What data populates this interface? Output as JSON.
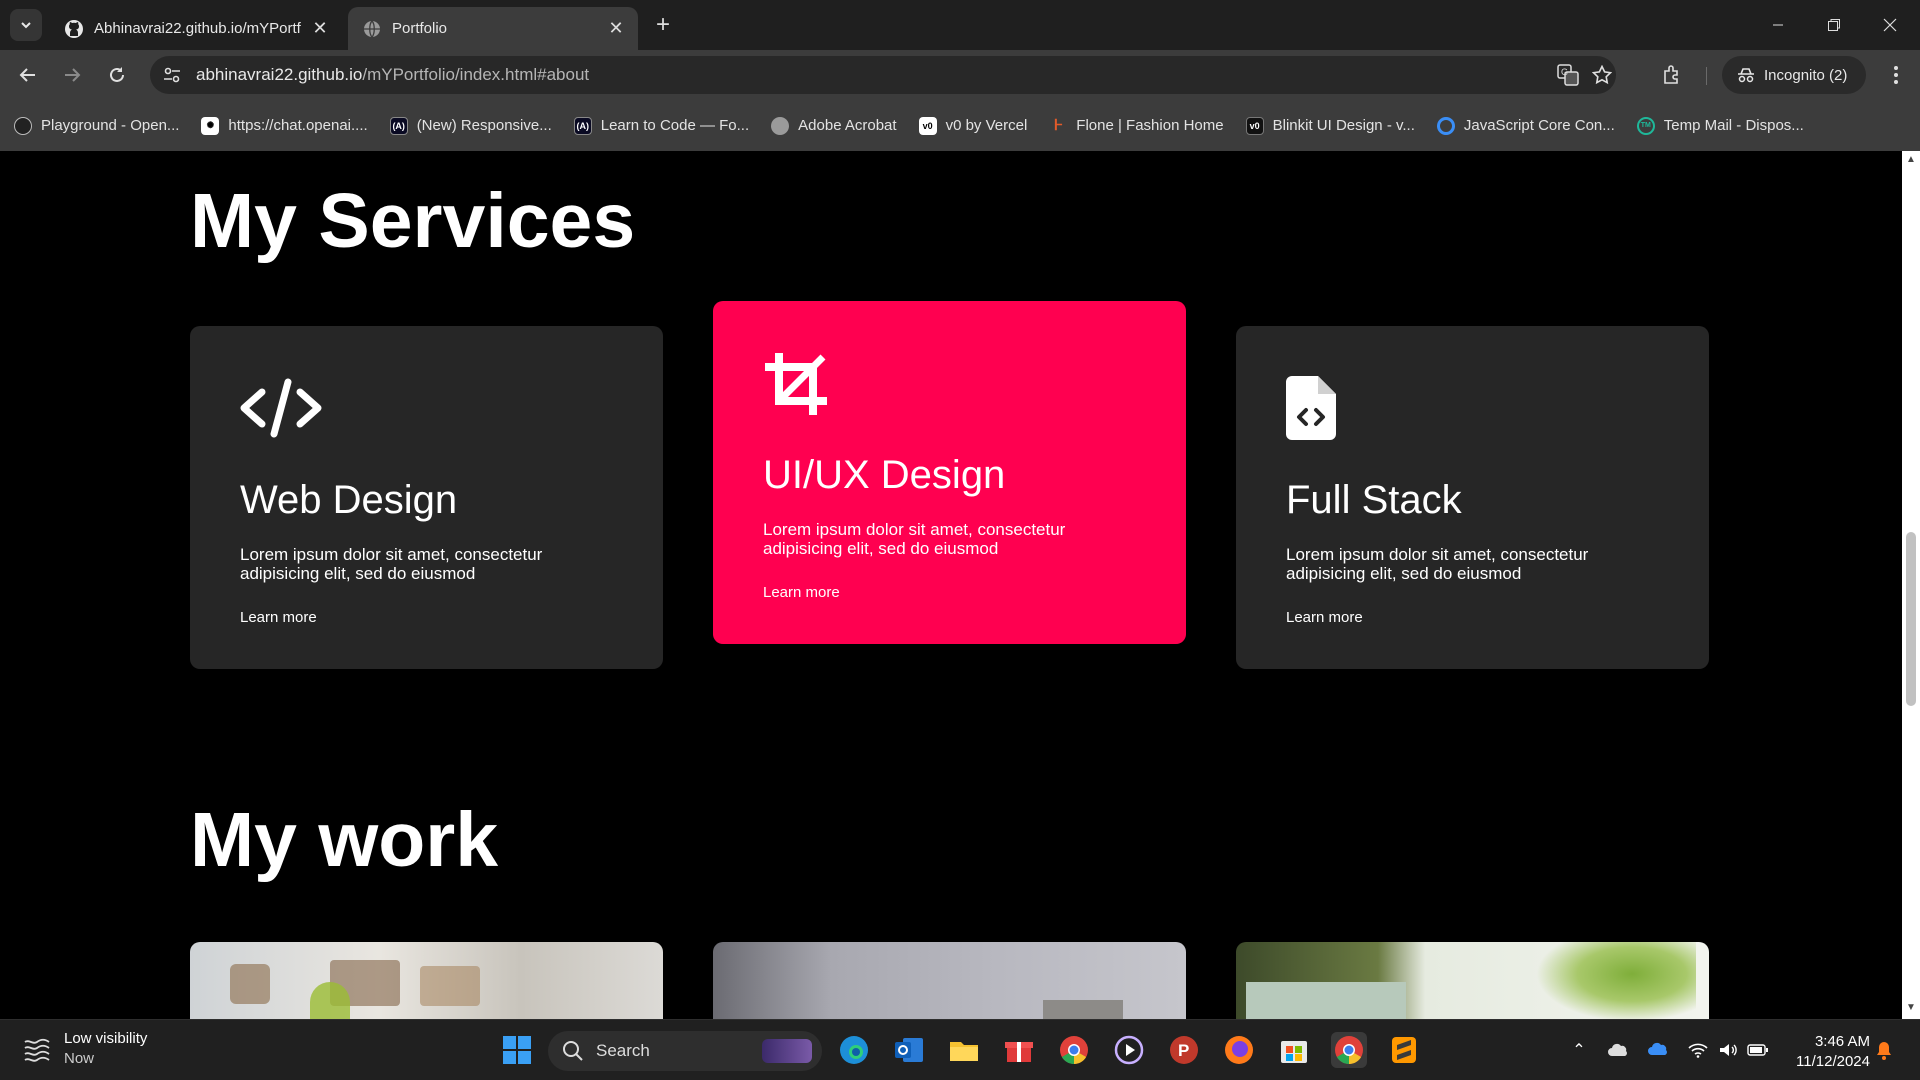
{
  "browser": {
    "tabs": [
      {
        "title": "Abhinavrai22.github.io/mYPortf",
        "icon": "github-icon",
        "active": false
      },
      {
        "title": "Portfolio",
        "icon": "globe-icon",
        "active": true
      }
    ],
    "url_host": "abhinavrai22.github.io",
    "url_path": "/mYPortfolio/index.html#about",
    "incognito_label": "Incognito (2)",
    "bookmarks": [
      {
        "label": "Playground - Open...",
        "icon": "openai-icon"
      },
      {
        "label": "https://chat.openai....",
        "icon": "openai-icon"
      },
      {
        "label": "(New) Responsive...",
        "icon": "code-angle-icon"
      },
      {
        "label": "Learn to Code — Fo...",
        "icon": "code-angle-icon"
      },
      {
        "label": "Adobe Acrobat",
        "icon": "globe-icon"
      },
      {
        "label": "v0 by Vercel",
        "icon": "v0-icon"
      },
      {
        "label": "Flone | Fashion Home",
        "icon": "flone-icon"
      },
      {
        "label": "Blinkit UI Design - v...",
        "icon": "v0-icon"
      },
      {
        "label": "JavaScript Core Con...",
        "icon": "q-icon"
      },
      {
        "label": "Temp Mail - Dispos...",
        "icon": "tempmail-icon"
      }
    ]
  },
  "page": {
    "services_title": "My Services",
    "services": [
      {
        "icon": "code-icon",
        "title": "Web Design",
        "desc": "Lorem ipsum dolor sit amet, consectetur adipisicing elit, sed do eiusmod",
        "link": "Learn more",
        "highlight": false
      },
      {
        "icon": "crop-icon",
        "title": "UI/UX Design",
        "desc": "Lorem ipsum dolor sit amet, consectetur adipisicing elit, sed do eiusmod",
        "link": "Learn more",
        "highlight": true
      },
      {
        "icon": "file-code-icon",
        "title": "Full Stack",
        "desc": "Lorem ipsum dolor sit amet, consectetur adipisicing elit, sed do eiusmod",
        "link": "Learn more",
        "highlight": false
      }
    ],
    "work_title": "My work",
    "accent_color": "#ff0050",
    "card_color": "#262626"
  },
  "taskbar": {
    "weather_title": "Low visibility",
    "weather_sub": "Now",
    "search_label": "Search",
    "time": "3:46 AM",
    "date": "11/12/2024"
  }
}
